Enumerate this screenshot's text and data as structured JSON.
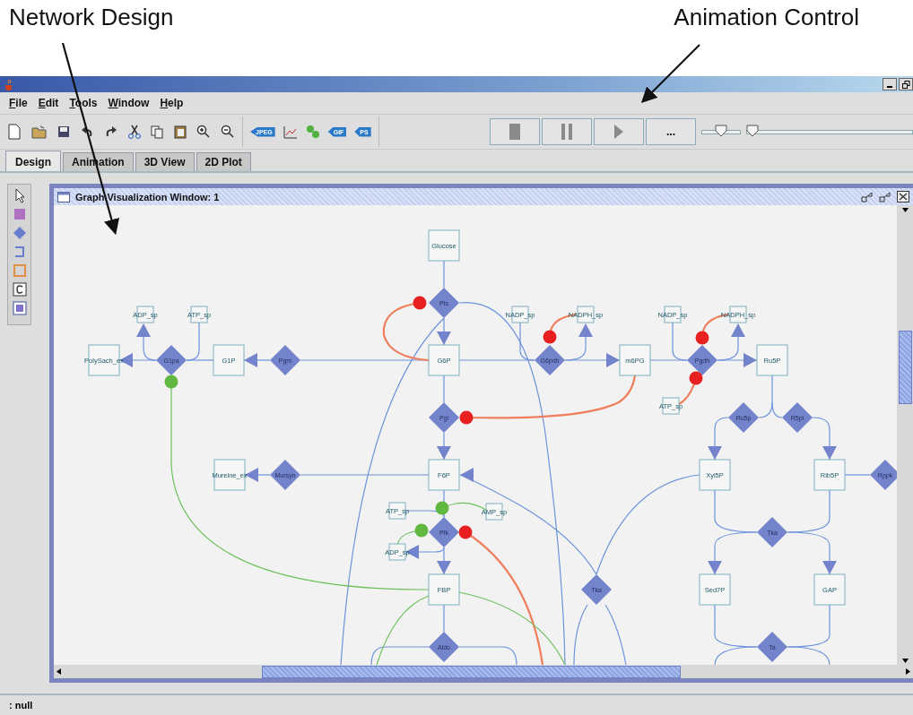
{
  "annotations": [
    {
      "text": "Network Design"
    },
    {
      "text": "Animation Control"
    }
  ],
  "menu": [
    "File",
    "Edit",
    "Tools",
    "Window",
    "Help"
  ],
  "export_labels": [
    "JPEG",
    "GIF",
    "PS"
  ],
  "animation": {
    "more_label": "...",
    "speed": {
      "level": 0.5
    },
    "position": {
      "level": 0
    }
  },
  "tabs": [
    {
      "label": "Design",
      "selected": true
    },
    {
      "label": "Animation",
      "selected": false
    },
    {
      "label": "3D View",
      "selected": false
    },
    {
      "label": "2D Plot",
      "selected": false
    }
  ],
  "graph_window": {
    "title": "Graph Visualization Window: 1",
    "species": [
      "Glucose",
      "ADP_sp",
      "ATP_sp",
      "NADP_sp",
      "NADPH_sp",
      "NADP_sp",
      "NADPH_sp",
      "PolySach_ex",
      "G1P",
      "G6P",
      "m6PG",
      "Ru5P",
      "ATP_sp",
      "Mureine_ex",
      "F6P",
      "Xyl5P",
      "Rib5P",
      "ATP_sp",
      "AMP_sp",
      "ADP_sp",
      "FBP",
      "Sed7P",
      "GAP"
    ],
    "reactions": [
      "Pts",
      "G1pa",
      "Pgm",
      "G6pdh",
      "Pgdh",
      "Pgi",
      "Ru5p",
      "R5pi",
      "Mursyn",
      "Rppk",
      "Pfk",
      "Tka",
      "Tka",
      "Aldo",
      "Ta"
    ],
    "modifiers": [
      {
        "color": "#e82020"
      },
      {
        "color": "#e82020"
      },
      {
        "color": "#e82020"
      },
      {
        "color": "#60b840"
      },
      {
        "color": "#e82020"
      },
      {
        "color": "#e82020"
      },
      {
        "color": "#60b840"
      },
      {
        "color": "#60b840"
      },
      {
        "color": "#e82020"
      }
    ]
  },
  "status_bar": ": null"
}
